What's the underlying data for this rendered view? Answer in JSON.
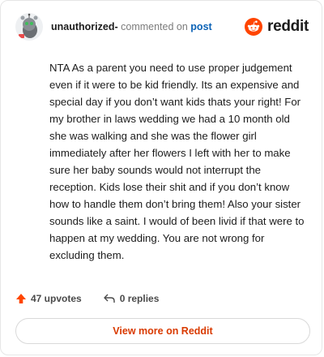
{
  "header": {
    "username": "unauthorized-",
    "action_text": "commented on",
    "target_text": "post",
    "brand_name": "reddit",
    "avatar_icon": "snoo-avatar-icon",
    "brand_icon": "reddit-alien-icon"
  },
  "comment": {
    "body": "NTA As a parent you need to use proper judgement even if it were to be kid friendly. Its an expensive and special day if you don’t want kids thats your right! For my brother in laws wedding we had a 10 month old she was walking and she was the flower girl immediately after her flowers I left with her to make sure her baby sounds would not interrupt the reception. Kids lose their shit and if you don’t know how to handle them don’t bring them! Also your sister sounds like a saint. I would of been livid if that were to happen at my wedding. You are not wrong for excluding them."
  },
  "stats": {
    "upvotes_text": "47 upvotes",
    "replies_text": "0 replies",
    "upvote_icon": "upvote-arrow-icon",
    "reply_icon": "reply-arrow-icon"
  },
  "footer": {
    "view_more_label": "View more on Reddit"
  },
  "colors": {
    "brand_orange": "#ff4500",
    "link_blue": "#0b62b6",
    "cta_text": "#d93a00",
    "upvote_orange": "#ff4500"
  }
}
